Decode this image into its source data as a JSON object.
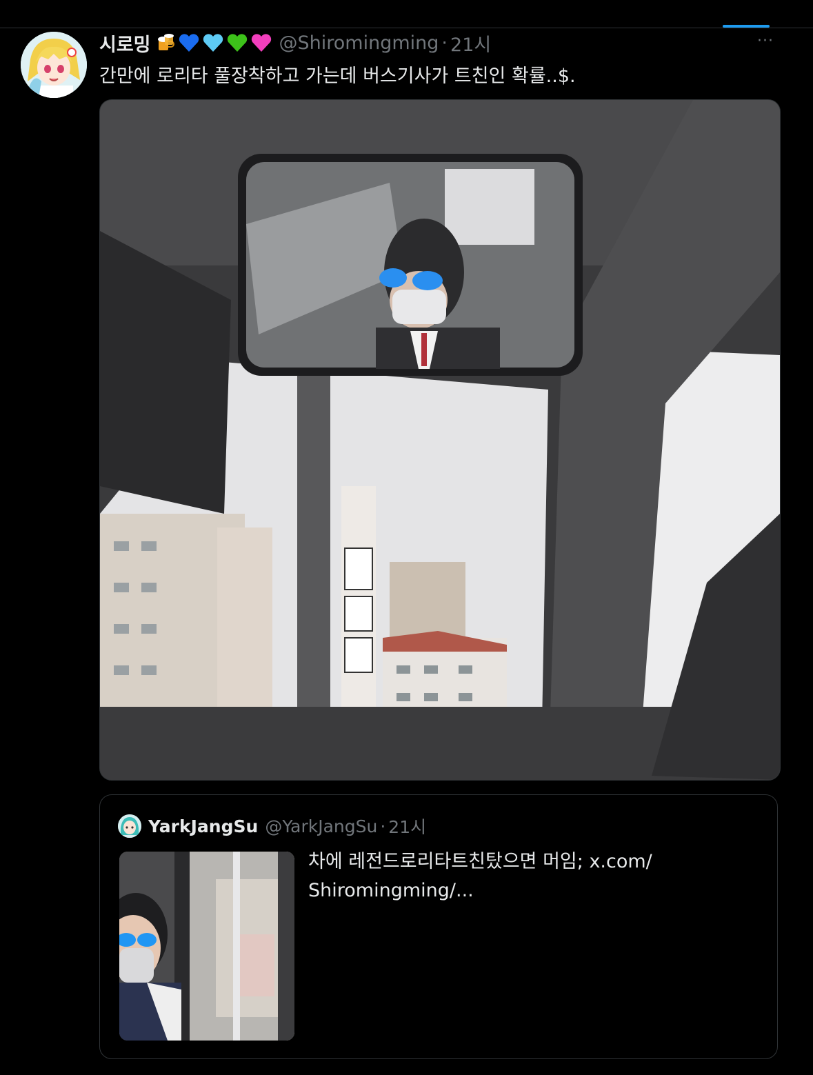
{
  "tweet": {
    "display_name": "시로밍",
    "handle": "@Shiromingming",
    "separator": "·",
    "time": "21시",
    "text": "간만에 로리타 풀장착하고 가는데 버스기사가 트친인 확률..$.",
    "more_label": "···",
    "name_emojis": [
      "beer-icon",
      "blue-heart-icon",
      "light-blue-heart-icon",
      "green-heart-icon",
      "pink-heart-icon"
    ]
  },
  "quote": {
    "display_name": "YarkJangSu",
    "handle": "@YarkJangSu",
    "separator": "·",
    "time": "21시",
    "text_line1": "차에 레전드로리타트친탔으면 머임; x.com/",
    "text_line2": "Shiromingming/..."
  },
  "colors": {
    "background": "#000000",
    "text_primary": "#e7e9ea",
    "text_secondary": "#71767b",
    "accent": "#1d9bf0",
    "border": "#2f3336"
  }
}
